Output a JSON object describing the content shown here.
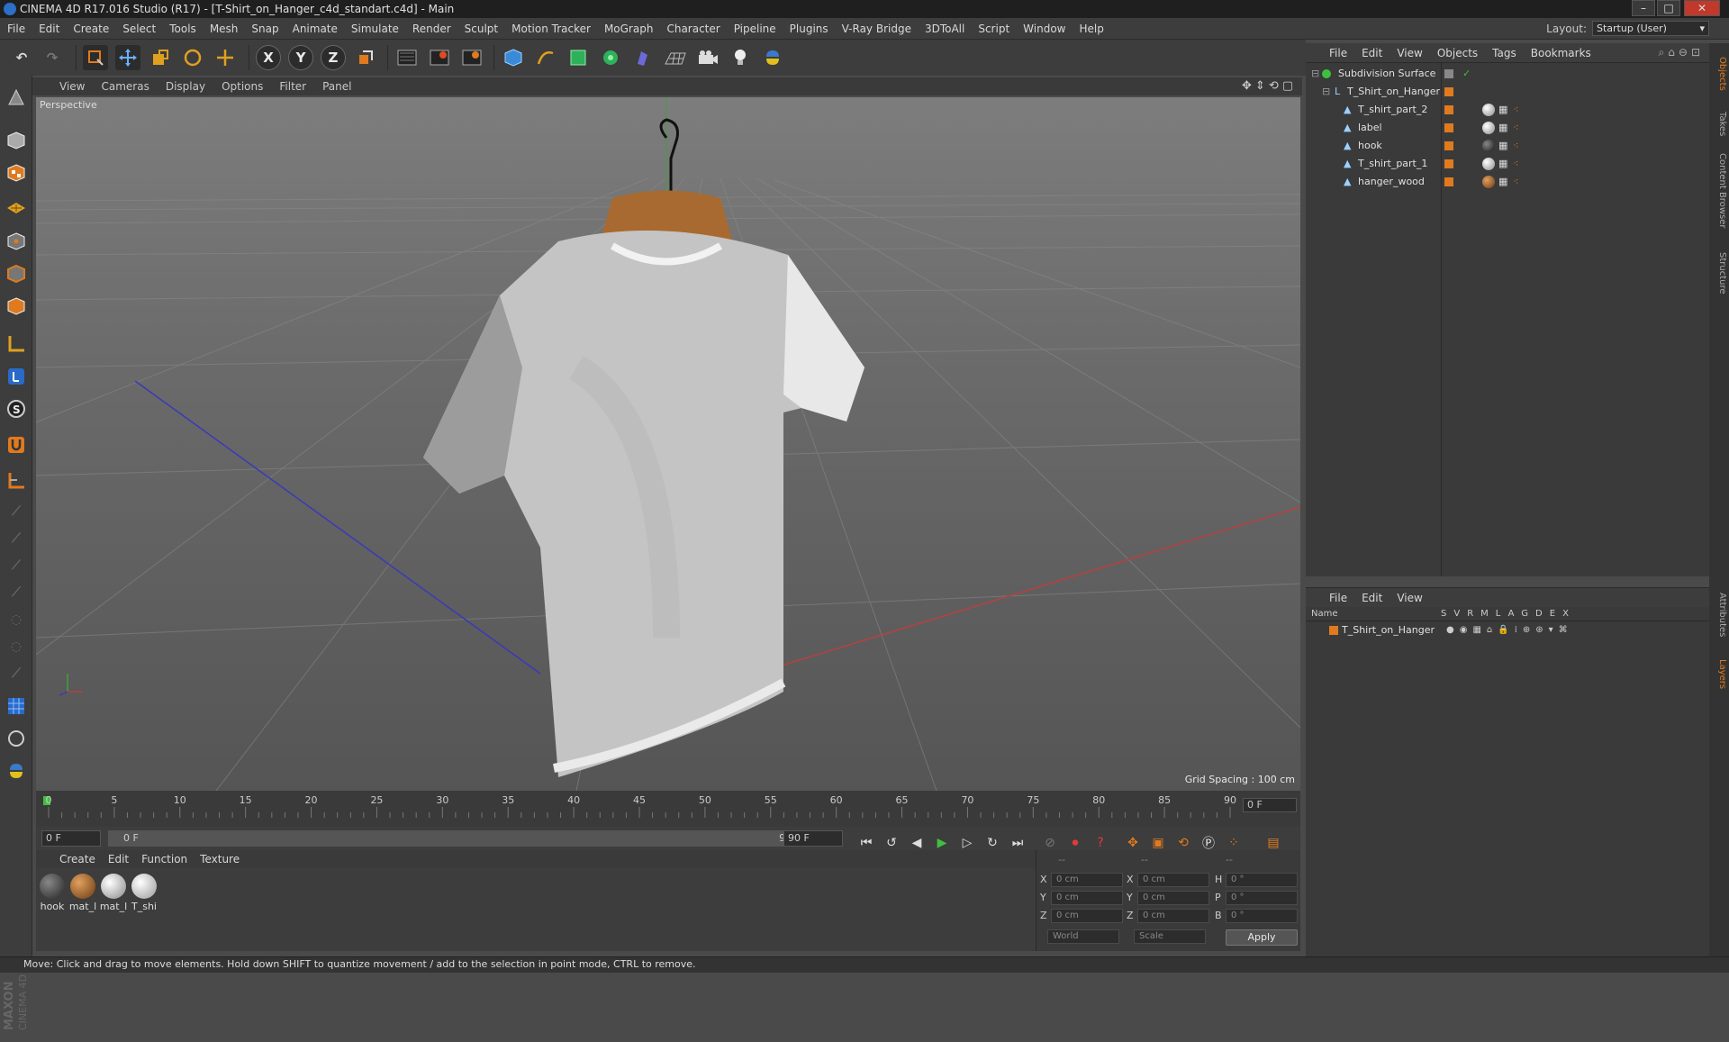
{
  "window": {
    "title": "CINEMA 4D R17.016 Studio (R17) - [T-Shirt_on_Hanger_c4d_standart.c4d] - Main"
  },
  "menu": [
    "File",
    "Edit",
    "Create",
    "Select",
    "Tools",
    "Mesh",
    "Snap",
    "Animate",
    "Simulate",
    "Render",
    "Sculpt",
    "Motion Tracker",
    "MoGraph",
    "Character",
    "Pipeline",
    "Plugins",
    "V-Ray Bridge",
    "3DToAll",
    "Script",
    "Window",
    "Help"
  ],
  "layout": {
    "label": "Layout:",
    "value": "Startup (User)"
  },
  "viewport": {
    "menu": [
      "View",
      "Cameras",
      "Display",
      "Options",
      "Filter",
      "Panel"
    ],
    "label": "Perspective",
    "grid_spacing": "Grid Spacing : 100 cm"
  },
  "timeline": {
    "ticks": [
      "0",
      "5",
      "10",
      "15",
      "20",
      "25",
      "30",
      "35",
      "40",
      "45",
      "50",
      "55",
      "60",
      "65",
      "70",
      "75",
      "80",
      "85",
      "90"
    ],
    "current_frame": "0 F"
  },
  "transport": {
    "start": "0 F",
    "range_start": "0 F",
    "range_end": "90 F",
    "end": "90 F"
  },
  "materials": {
    "menu": [
      "Create",
      "Edit",
      "Function",
      "Texture"
    ],
    "items": [
      {
        "label": "hook",
        "color": "#3a3a3a"
      },
      {
        "label": "mat_l",
        "color": "#8a5a2b"
      },
      {
        "label": "mat_l",
        "color": "#cfcfcf"
      },
      {
        "label": "T_shi",
        "color": "#dcdcdc"
      }
    ]
  },
  "coords": {
    "header": [
      "--",
      "--",
      "--"
    ],
    "rows": [
      {
        "a": "X",
        "v1": "0 cm",
        "b": "X",
        "v2": "0 cm",
        "c": "H",
        "v3": "0 °"
      },
      {
        "a": "Y",
        "v1": "0 cm",
        "b": "Y",
        "v2": "0 cm",
        "c": "P",
        "v3": "0 °"
      },
      {
        "a": "Z",
        "v1": "0 cm",
        "b": "Z",
        "v2": "0 cm",
        "c": "B",
        "v3": "0 °"
      }
    ],
    "world": "World",
    "scale": "Scale",
    "apply": "Apply"
  },
  "objects": {
    "menu": [
      "File",
      "Edit",
      "View",
      "Objects",
      "Tags",
      "Bookmarks"
    ],
    "items": [
      {
        "name": "Subdivision Surface",
        "indent": 0
      },
      {
        "name": "T_Shirt_on_Hanger",
        "indent": 1
      },
      {
        "name": "T_shirt_part_2",
        "indent": 2
      },
      {
        "name": "label",
        "indent": 2
      },
      {
        "name": "hook",
        "indent": 2
      },
      {
        "name": "T_shirt_part_1",
        "indent": 2
      },
      {
        "name": "hanger_wood",
        "indent": 2
      }
    ]
  },
  "layers": {
    "menu": [
      "File",
      "Edit",
      "View"
    ],
    "columns": "Name",
    "flags": [
      "S",
      "V",
      "R",
      "M",
      "L",
      "A",
      "G",
      "D",
      "E",
      "X"
    ],
    "items": [
      "T_Shirt_on_Hanger"
    ]
  },
  "side_tabs": [
    "Objects",
    "Takes",
    "Content Browser",
    "Structure",
    "Attributes",
    "Layers"
  ],
  "status": "Move: Click and drag to move elements. Hold down SHIFT to quantize movement / add to the selection in point mode, CTRL to remove.",
  "brand": {
    "line1": "MAXON",
    "line2": "CINEMA 4D"
  },
  "colors": {
    "accent": "#e07a1f",
    "bg": "#3d3d3d"
  }
}
